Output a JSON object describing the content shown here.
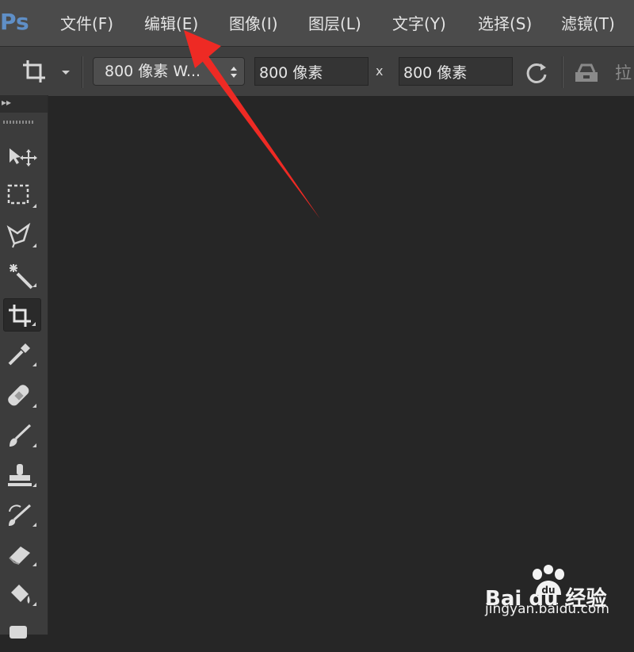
{
  "app": {
    "logo_text": "Ps"
  },
  "menu": {
    "items": [
      {
        "label": "文件(F)"
      },
      {
        "label": "编辑(E)"
      },
      {
        "label": "图像(I)"
      },
      {
        "label": "图层(L)"
      },
      {
        "label": "文字(Y)"
      },
      {
        "label": "选择(S)"
      },
      {
        "label": "滤镜(T)"
      }
    ]
  },
  "options": {
    "ratio_select_value": "800 像素 W...",
    "width_value": "800 像素",
    "times_symbol": "x",
    "height_value": "800 像素",
    "straighten_label": "拉"
  },
  "toolbar": {
    "tools": [
      {
        "name": "move-tool",
        "icon": "move-icon"
      },
      {
        "name": "marquee-tool",
        "icon": "rect-marquee-icon"
      },
      {
        "name": "lasso-tool",
        "icon": "polygon-lasso-icon"
      },
      {
        "name": "magic-wand-tool",
        "icon": "magic-wand-icon"
      },
      {
        "name": "crop-tool",
        "icon": "crop-icon",
        "active": true
      },
      {
        "name": "eyedropper-tool",
        "icon": "eyedropper-icon"
      },
      {
        "name": "healing-brush-tool",
        "icon": "bandage-icon"
      },
      {
        "name": "brush-tool",
        "icon": "brush-icon"
      },
      {
        "name": "clone-stamp-tool",
        "icon": "stamp-icon"
      },
      {
        "name": "history-brush-tool",
        "icon": "history-brush-icon"
      },
      {
        "name": "eraser-tool",
        "icon": "eraser-icon"
      },
      {
        "name": "paint-bucket-tool",
        "icon": "bucket-icon"
      }
    ]
  },
  "annotation": {
    "color": "#ee2a24"
  },
  "watermark": {
    "brand": "Bai du 经验",
    "url": "jingyan.baidu.com"
  },
  "colors": {
    "menubar_bg": "#4b4b4b",
    "optionsbar_bg": "#3f3f3f",
    "canvas_bg": "#262626",
    "logo": "#5f8fc7"
  }
}
